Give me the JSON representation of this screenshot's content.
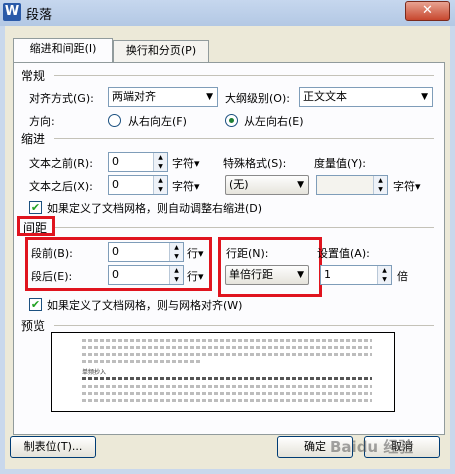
{
  "window": {
    "title": "段落",
    "app_icon_letter": "W",
    "close_glyph": "✕"
  },
  "tabs": [
    {
      "label": "缩进和间距(I)"
    },
    {
      "label": "换行和分页(P)"
    }
  ],
  "general": {
    "section": "常规",
    "alignment_label": "对齐方式(G):",
    "alignment_value": "两端对齐",
    "outline_label": "大纲级别(O):",
    "outline_value": "正文文本",
    "direction_label": "方向:",
    "rtl_label": "从右向左(F)",
    "ltr_label": "从左向右(E)",
    "direction_selected": "从左向右"
  },
  "indent": {
    "section": "缩进",
    "before_label": "文本之前(R):",
    "before_value": "0",
    "before_unit": "字符▾",
    "after_label": "文本之后(X):",
    "after_value": "0",
    "after_unit": "字符▾",
    "special_label": "特殊格式(S):",
    "special_value": "(无)",
    "measure_label": "度量值(Y):",
    "measure_value": "",
    "measure_unit": "字符▾",
    "grid_check_label": "如果定义了文档网格，则自动调整右缩进(D)",
    "grid_checked": true
  },
  "spacing": {
    "section": "间距",
    "before_label": "段前(B):",
    "before_value": "0",
    "before_unit": "行▾",
    "after_label": "段后(E):",
    "after_value": "0",
    "after_unit": "行▾",
    "line_label": "行距(N):",
    "line_value": "单倍行距",
    "setting_label": "设置值(A):",
    "setting_value": "1",
    "setting_unit": "倍",
    "grid_check_label": "如果定义了文档网格，则与网格对齐(W)",
    "grid_checked": true
  },
  "preview": {
    "section": "预览",
    "sample_text": "单频抄入"
  },
  "buttons": {
    "tabs": "制表位(T)...",
    "ok": "确定",
    "cancel": "取消"
  },
  "watermark": "Baidu 经验",
  "colors": {
    "highlight_box": "#e0141e",
    "titlebar": "#b3c8e4",
    "dialog_bg": "#ece9d8"
  }
}
